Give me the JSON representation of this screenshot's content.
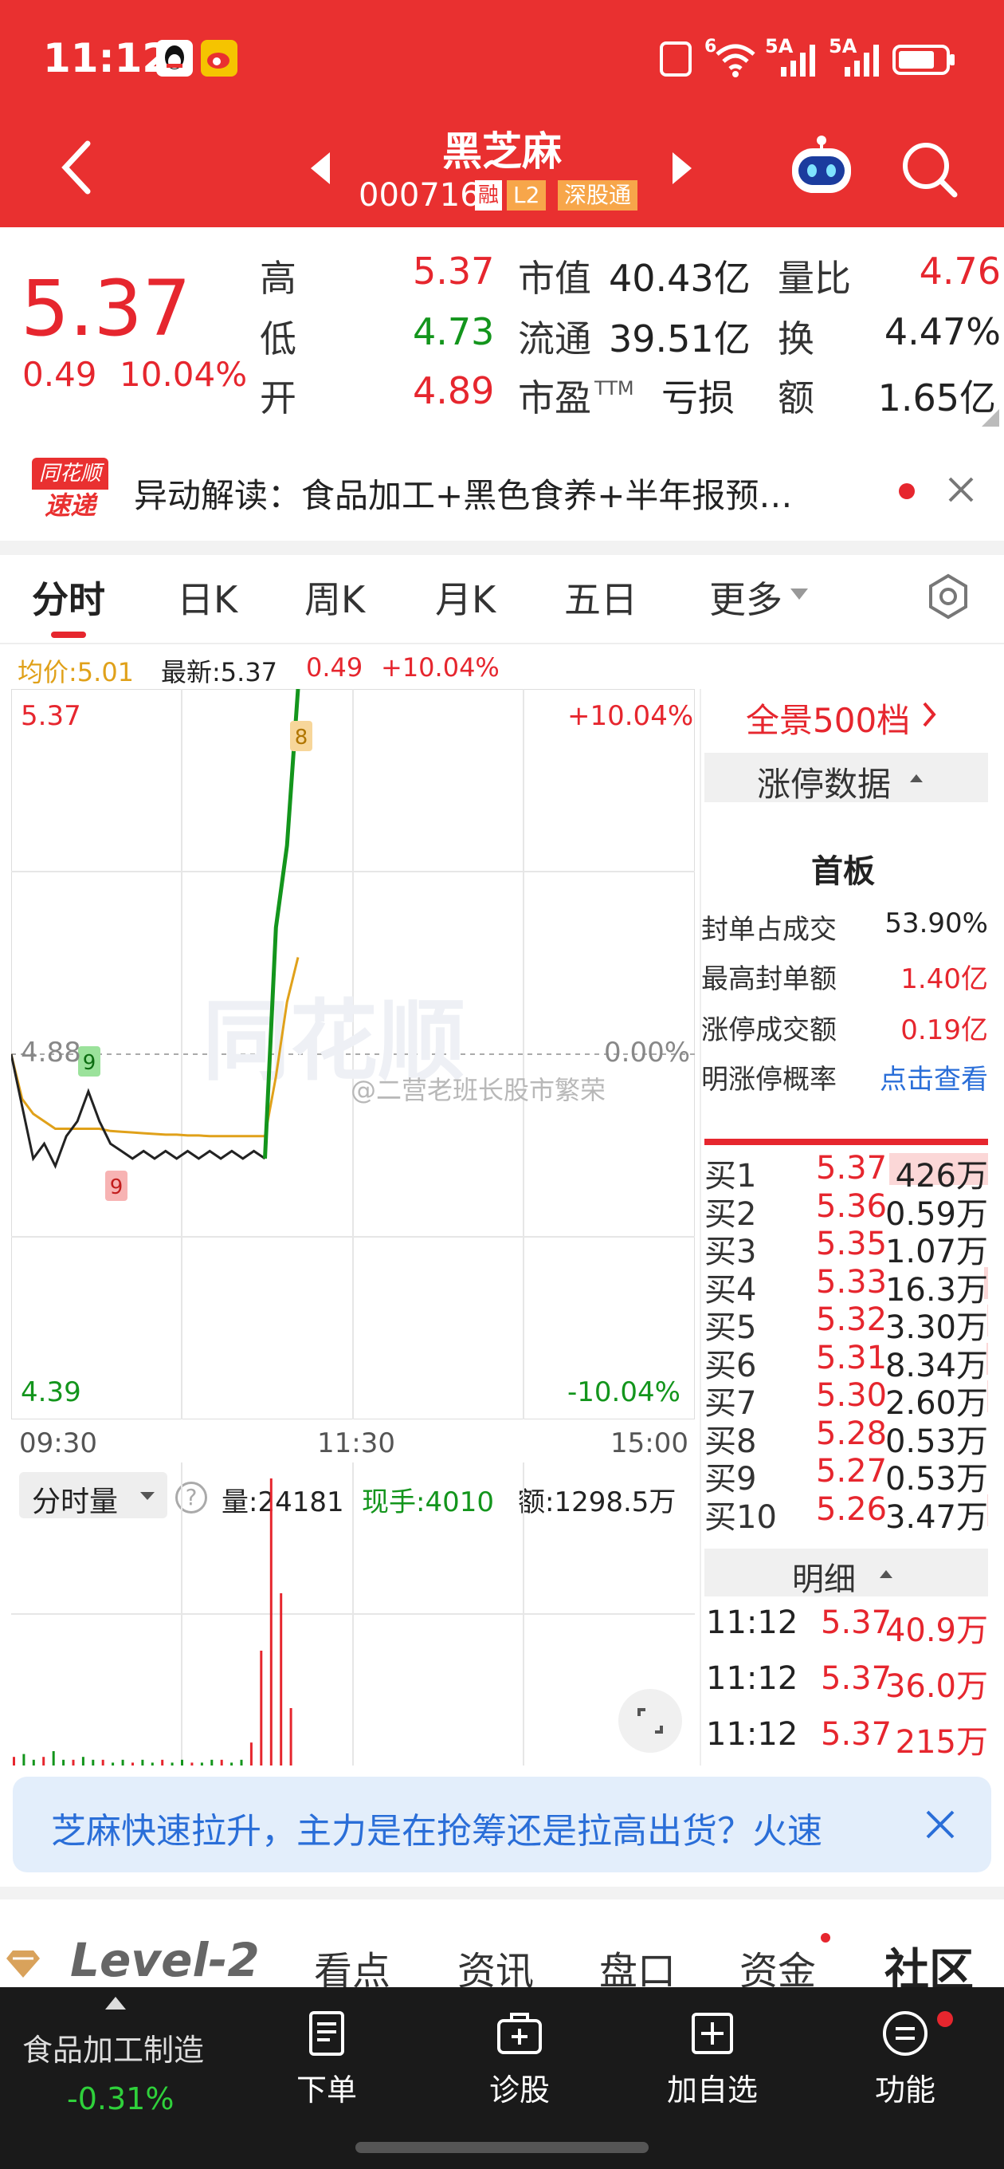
{
  "status": {
    "time": "11:12",
    "net1": "5A",
    "net2": "5A",
    "net3": "6"
  },
  "header": {
    "title": "黑芝麻",
    "code": "000716",
    "badge_rong": "融",
    "badge_l2": "L2",
    "badge_sgt": "深股通"
  },
  "quote": {
    "price": "5.37",
    "change": "0.49",
    "change_pct": "10.04%",
    "high_label": "高",
    "high": "5.37",
    "low_label": "低",
    "low": "4.73",
    "open_label": "开",
    "open": "4.89",
    "mcap_label": "市值",
    "mcap": "40.43亿",
    "float_label": "流通",
    "float": "39.51亿",
    "pe_label": "市盈",
    "pe_sup": "TTM",
    "pe": "亏损",
    "volratio_label": "量比",
    "volratio": "4.76",
    "turnover_label": "换",
    "turnover": "4.47%",
    "amount_label": "额",
    "amount": "1.65亿"
  },
  "news": {
    "logo_top": "同花顺",
    "logo_bottom": "速递",
    "text": "异动解读：食品加工+黑色食养+半年报预…"
  },
  "tabs": [
    {
      "label": "分时"
    },
    {
      "label": "日K"
    },
    {
      "label": "周K"
    },
    {
      "label": "月K"
    },
    {
      "label": "五日"
    },
    {
      "label": "更多"
    }
  ],
  "chart_info": {
    "avg": "均价:5.01",
    "latest": "最新:5.37",
    "chg": "0.49",
    "chg_pct": "+10.04%"
  },
  "chart_labels": {
    "top_price": "5.37",
    "top_pct": "+10.04%",
    "mid_price": "4.88",
    "mid_pct": "0.00%",
    "bot_price": "4.39",
    "bot_pct": "-10.04%",
    "t_start": "09:30",
    "t_mid": "11:30",
    "t_end": "15:00",
    "marker_b": "9",
    "marker_s": "9",
    "marker_top": "8",
    "watermark": "同花顺",
    "weibo": "@二营老班长股市繁荣"
  },
  "volume_info": {
    "selector": "分时量",
    "qty": "量:24181",
    "hand": "现手:4010",
    "amt": "额:1298.5万"
  },
  "chart_data": {
    "type": "line",
    "title": "",
    "xlabel": "",
    "ylabel": "",
    "x_ticks": [
      "09:30",
      "11:30",
      "15:00"
    ],
    "ylim": [
      4.39,
      5.37
    ],
    "prev_close": 4.88,
    "series": [
      {
        "name": "最新",
        "values": [
          4.88,
          4.81,
          4.74,
          4.76,
          4.73,
          4.77,
          4.79,
          4.83,
          4.79,
          4.76,
          4.75,
          4.74,
          4.75,
          4.74,
          4.75,
          4.74,
          4.75,
          4.74,
          4.75,
          4.74,
          4.75,
          4.74,
          4.75,
          4.74,
          5.05,
          5.16,
          5.37
        ]
      },
      {
        "name": "均价",
        "values": [
          4.88,
          4.82,
          4.8,
          4.79,
          4.78,
          4.78,
          4.78,
          4.78,
          4.78,
          4.777,
          4.776,
          4.775,
          4.774,
          4.773,
          4.772,
          4.772,
          4.771,
          4.771,
          4.77,
          4.77,
          4.77,
          4.77,
          4.77,
          4.77,
          4.85,
          4.95,
          5.01
        ]
      }
    ],
    "volume": [
      3,
      4,
      2,
      3,
      5,
      2,
      2,
      3,
      2,
      2,
      1,
      2,
      1,
      2,
      1,
      2,
      1,
      2,
      1,
      1,
      2,
      2,
      1,
      2,
      8,
      40,
      100,
      60,
      20
    ]
  },
  "panel": {
    "full_depth": "全景500档",
    "limit_header": "涨停数据",
    "board": "首板",
    "limit_rows": [
      {
        "label": "封单占成交",
        "value": "53.90%"
      },
      {
        "label": "最高封单额",
        "value": "1.40亿"
      },
      {
        "label": "涨停成交额",
        "value": "0.19亿"
      },
      {
        "label": "明涨停概率",
        "value": "点击查看"
      }
    ],
    "bids": [
      {
        "label": "买1",
        "price": "5.37",
        "qty": "426万",
        "bar": 1.0
      },
      {
        "label": "买2",
        "price": "5.36",
        "qty": "0.59万",
        "bar": 0.0
      },
      {
        "label": "买3",
        "price": "5.35",
        "qty": "1.07万",
        "bar": 0.0
      },
      {
        "label": "买4",
        "price": "5.33",
        "qty": "16.3万",
        "bar": 0.04
      },
      {
        "label": "买5",
        "price": "5.32",
        "qty": "3.30万",
        "bar": 0.01
      },
      {
        "label": "买6",
        "price": "5.31",
        "qty": "8.34万",
        "bar": 0.02
      },
      {
        "label": "买7",
        "price": "5.30",
        "qty": "2.60万",
        "bar": 0.01
      },
      {
        "label": "买8",
        "price": "5.28",
        "qty": "0.53万",
        "bar": 0.0
      },
      {
        "label": "买9",
        "price": "5.27",
        "qty": "0.53万",
        "bar": 0.0
      },
      {
        "label": "买10",
        "price": "5.26",
        "qty": "3.47万",
        "bar": 0.01
      }
    ],
    "detail_header": "明细",
    "details": [
      {
        "time": "11:12",
        "price": "5.37",
        "qty": "40.9万"
      },
      {
        "time": "11:12",
        "price": "5.37",
        "qty": "36.0万"
      },
      {
        "time": "11:12",
        "price": "5.37",
        "qty": "215万"
      }
    ]
  },
  "banner": {
    "text": "芝麻快速拉升，主力是在抢筹还是拉高出货？火速"
  },
  "subtabs": [
    {
      "label": "Level-2"
    },
    {
      "label": "看点"
    },
    {
      "label": "资讯"
    },
    {
      "label": "盘口"
    },
    {
      "label": "资金"
    },
    {
      "label": "社区"
    }
  ],
  "bottom": {
    "sector_name": "食品加工制造",
    "sector_chg": "-0.31%",
    "items": [
      {
        "label": "下单"
      },
      {
        "label": "诊股"
      },
      {
        "label": "加自选"
      },
      {
        "label": "功能"
      }
    ]
  },
  "colors": {
    "brand_red": "#e93030",
    "up_red": "#e6262e",
    "down_green": "#13951c",
    "avg_orange": "#e0a11a",
    "dark_nav": "#1a1a1a"
  }
}
